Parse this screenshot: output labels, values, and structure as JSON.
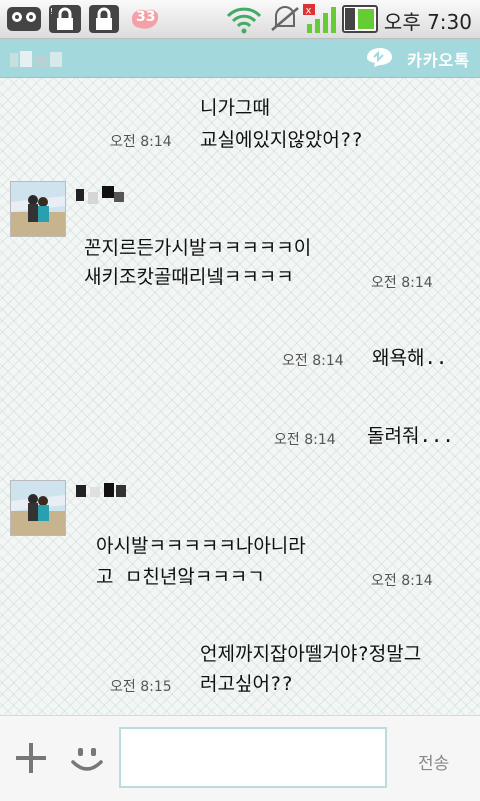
{
  "status_bar": {
    "notification_count": "33",
    "time": "오후 7:30",
    "icons": [
      "cassette-tape-icon",
      "lock-icon",
      "lock-icon",
      "notification-badge-icon",
      "wifi-icon",
      "mute-icon",
      "signal-icon",
      "battery-icon"
    ]
  },
  "header": {
    "brand": "카카오톡"
  },
  "messages": [
    {
      "type": "sent",
      "lines": [
        "니가그때",
        "교실에있지않았어??"
      ],
      "time": "오전 8:14"
    },
    {
      "type": "received",
      "lines": [
        "꼰지르든가시발ㅋㅋㅋㅋㅋ이",
        "새키조캇골때리넼ㅋㅋㅋㅋ"
      ],
      "time": "오전 8:14"
    },
    {
      "type": "sent",
      "lines": [
        "왜욕해.."
      ],
      "time": "오전 8:14"
    },
    {
      "type": "sent",
      "lines": [
        "돌려줘..."
      ],
      "time": "오전 8:14"
    },
    {
      "type": "received",
      "lines": [
        "아시발ㅋㅋㅋㅋㅋ나아니라",
        "고 ㅁ친년앜ㅋㅋㅋㄱ"
      ],
      "time": "오전 8:14"
    },
    {
      "type": "sent",
      "lines": [
        "언제까지잡아뗄거야?정말그",
        "러고싶어??"
      ],
      "time": "오전 8:15"
    }
  ],
  "input_bar": {
    "send_label": "전송",
    "message_placeholder": ""
  },
  "colors": {
    "header_bg": "#a3d9dc",
    "chat_bg": "#f3f6f4",
    "input_border": "#b9dcdd"
  }
}
